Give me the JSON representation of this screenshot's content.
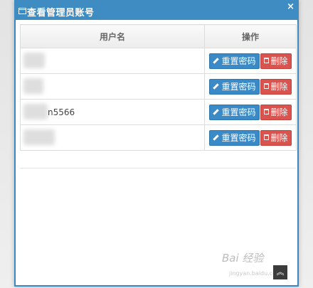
{
  "dialog": {
    "title": "查看管理员账号",
    "close_symbol": "×"
  },
  "table": {
    "columns": [
      "用户名",
      "操作"
    ],
    "rows": [
      {
        "username": ""
      },
      {
        "username": ""
      },
      {
        "username": "n5566"
      },
      {
        "username": ""
      }
    ],
    "reset_label": "重置密码",
    "delete_label": "删除"
  },
  "colors": {
    "title_bar": "#3f8cc3",
    "reset_button": "#3a8ac7",
    "delete_button": "#d9534f"
  },
  "icons": {
    "title": "window-icon",
    "close": "close-icon",
    "reset": "pencil-icon",
    "delete": "trash-icon",
    "scroll": "chevron-up-icon"
  },
  "scroll_top_symbol": "︽",
  "watermark": {
    "text": "Bai 经验",
    "sub": "jingyan.baidu.com"
  }
}
